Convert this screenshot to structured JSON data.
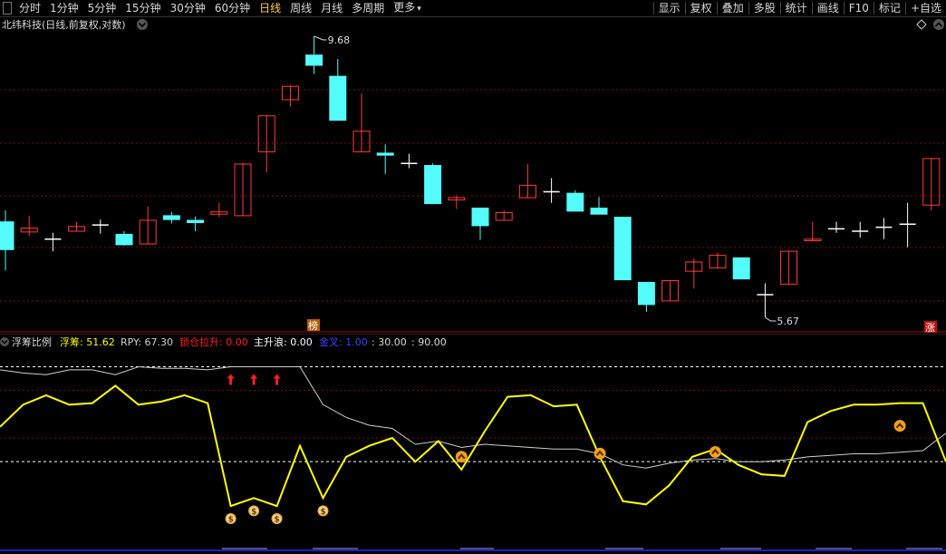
{
  "toolbar": {
    "periods": [
      "分时",
      "1分钟",
      "5分钟",
      "15分钟",
      "30分钟",
      "60分钟",
      "日线",
      "周线",
      "月线",
      "多周期",
      "更多"
    ],
    "active": "日线",
    "tools": [
      "显示",
      "复权",
      "叠加",
      "多股",
      "统计",
      "画线",
      "F10",
      "标记",
      "+自选"
    ]
  },
  "main_panel": {
    "title": "北纬科技(日线,前复权,对数)",
    "high_label": "9.68",
    "low_label": "5.67",
    "badge_bang": "榜",
    "badge_zhang": "涨",
    "colors": {
      "up": "#ff3c3c",
      "down": "#54fcfc",
      "doji": "#ffffff"
    }
  },
  "indicator_panel": {
    "name": "浮筹比例",
    "fuchou_label": "浮筹: 51.62",
    "rpy_label": "RPY: 67.30",
    "lock_label": "锁仓拉升: 0.00",
    "wave_label": "主升浪: 0.00",
    "gold_label": "金叉: 1.00",
    "lv1_label": ": 30.00",
    "lv2_label": ": 90.00",
    "colors": {
      "fuchou": "#ffff00",
      "rpy": "#cfcfcf",
      "lock": "#ff2020",
      "wave": "#ffffff",
      "gold": "#4040ff"
    }
  },
  "chart_data": {
    "type": "candlestick",
    "candles": [
      {
        "o": 6.8,
        "c": 6.45,
        "h": 6.95,
        "l": 6.2
      },
      {
        "o": 6.67,
        "c": 6.72,
        "h": 6.88,
        "l": 6.62
      },
      {
        "o": 6.58,
        "c": 6.57,
        "h": 6.66,
        "l": 6.43
      },
      {
        "o": 6.68,
        "c": 6.74,
        "h": 6.8,
        "l": 6.68
      },
      {
        "o": 6.76,
        "c": 6.75,
        "h": 6.83,
        "l": 6.65
      },
      {
        "o": 6.64,
        "c": 6.51,
        "h": 6.68,
        "l": 6.5
      },
      {
        "o": 6.52,
        "c": 6.82,
        "h": 7.0,
        "l": 6.52
      },
      {
        "o": 6.88,
        "c": 6.83,
        "h": 6.93,
        "l": 6.78
      },
      {
        "o": 6.82,
        "c": 6.79,
        "h": 6.87,
        "l": 6.68
      },
      {
        "o": 6.9,
        "c": 6.93,
        "h": 7.05,
        "l": 6.86
      },
      {
        "o": 6.88,
        "c": 7.59,
        "h": 7.61,
        "l": 6.88
      },
      {
        "o": 7.77,
        "c": 8.32,
        "h": 8.32,
        "l": 7.47
      },
      {
        "o": 8.58,
        "c": 8.8,
        "h": 8.82,
        "l": 8.47
      },
      {
        "o": 9.34,
        "c": 9.16,
        "h": 9.68,
        "l": 9.01
      },
      {
        "o": 8.97,
        "c": 8.25,
        "h": 9.27,
        "l": 8.25
      },
      {
        "o": 7.77,
        "c": 8.08,
        "h": 8.68,
        "l": 7.77
      },
      {
        "o": 7.75,
        "c": 7.72,
        "h": 7.88,
        "l": 7.45
      },
      {
        "o": 7.6,
        "c": 7.59,
        "h": 7.74,
        "l": 7.53
      },
      {
        "o": 7.57,
        "c": 7.04,
        "h": 7.6,
        "l": 7.04
      },
      {
        "o": 7.09,
        "c": 7.12,
        "h": 7.15,
        "l": 6.97
      },
      {
        "o": 6.98,
        "c": 6.75,
        "h": 6.98,
        "l": 6.57
      },
      {
        "o": 6.82,
        "c": 6.92,
        "h": 6.95,
        "l": 6.82
      },
      {
        "o": 7.12,
        "c": 7.29,
        "h": 7.59,
        "l": 7.12
      },
      {
        "o": 7.2,
        "c": 7.19,
        "h": 7.39,
        "l": 7.05
      },
      {
        "o": 7.18,
        "c": 6.94,
        "h": 7.22,
        "l": 6.94
      },
      {
        "o": 6.98,
        "c": 6.9,
        "h": 7.13,
        "l": 6.9
      },
      {
        "o": 6.86,
        "c": 6.09,
        "h": 6.86,
        "l": 6.09
      },
      {
        "o": 6.06,
        "c": 5.81,
        "h": 6.06,
        "l": 5.73
      },
      {
        "o": 5.85,
        "c": 6.08,
        "h": 6.08,
        "l": 5.85
      },
      {
        "o": 6.19,
        "c": 6.3,
        "h": 6.34,
        "l": 5.99
      },
      {
        "o": 6.23,
        "c": 6.38,
        "h": 6.41,
        "l": 6.23
      },
      {
        "o": 6.35,
        "c": 6.1,
        "h": 6.35,
        "l": 6.1
      },
      {
        "o": 5.91,
        "c": 5.92,
        "h": 6.05,
        "l": 5.67
      },
      {
        "o": 6.04,
        "c": 6.43,
        "h": 6.43,
        "l": 6.04
      },
      {
        "o": 6.56,
        "c": 6.58,
        "h": 6.8,
        "l": 6.56
      },
      {
        "o": 6.7,
        "c": 6.71,
        "h": 6.8,
        "l": 6.66
      },
      {
        "o": 6.67,
        "c": 6.68,
        "h": 6.8,
        "l": 6.6
      },
      {
        "o": 6.72,
        "c": 6.73,
        "h": 6.85,
        "l": 6.58
      },
      {
        "o": 6.76,
        "c": 6.77,
        "h": 7.05,
        "l": 6.48
      },
      {
        "o": 7.02,
        "c": 7.67,
        "h": 7.67,
        "l": 6.95
      }
    ],
    "indicator": {
      "fuchou": [
        52,
        66,
        72,
        66,
        67,
        78,
        66,
        68,
        72,
        67,
        2,
        7,
        2,
        40,
        7,
        33,
        40,
        45,
        30,
        43,
        25,
        49,
        71,
        72,
        65,
        66,
        33,
        5,
        3,
        15,
        33,
        38,
        28,
        22,
        21,
        55,
        62,
        66,
        66,
        67,
        67,
        30
      ],
      "rpy": [
        88,
        86,
        85,
        88,
        88,
        85,
        90,
        89,
        89,
        88,
        90,
        90,
        90,
        90,
        66,
        58,
        53,
        51,
        41,
        43,
        39,
        41,
        40,
        39,
        38,
        38,
        35,
        28,
        26,
        29,
        31,
        32,
        30,
        30,
        31,
        33,
        34,
        35,
        35,
        36,
        37,
        48
      ],
      "ylim": [
        -10,
        100
      ]
    }
  }
}
